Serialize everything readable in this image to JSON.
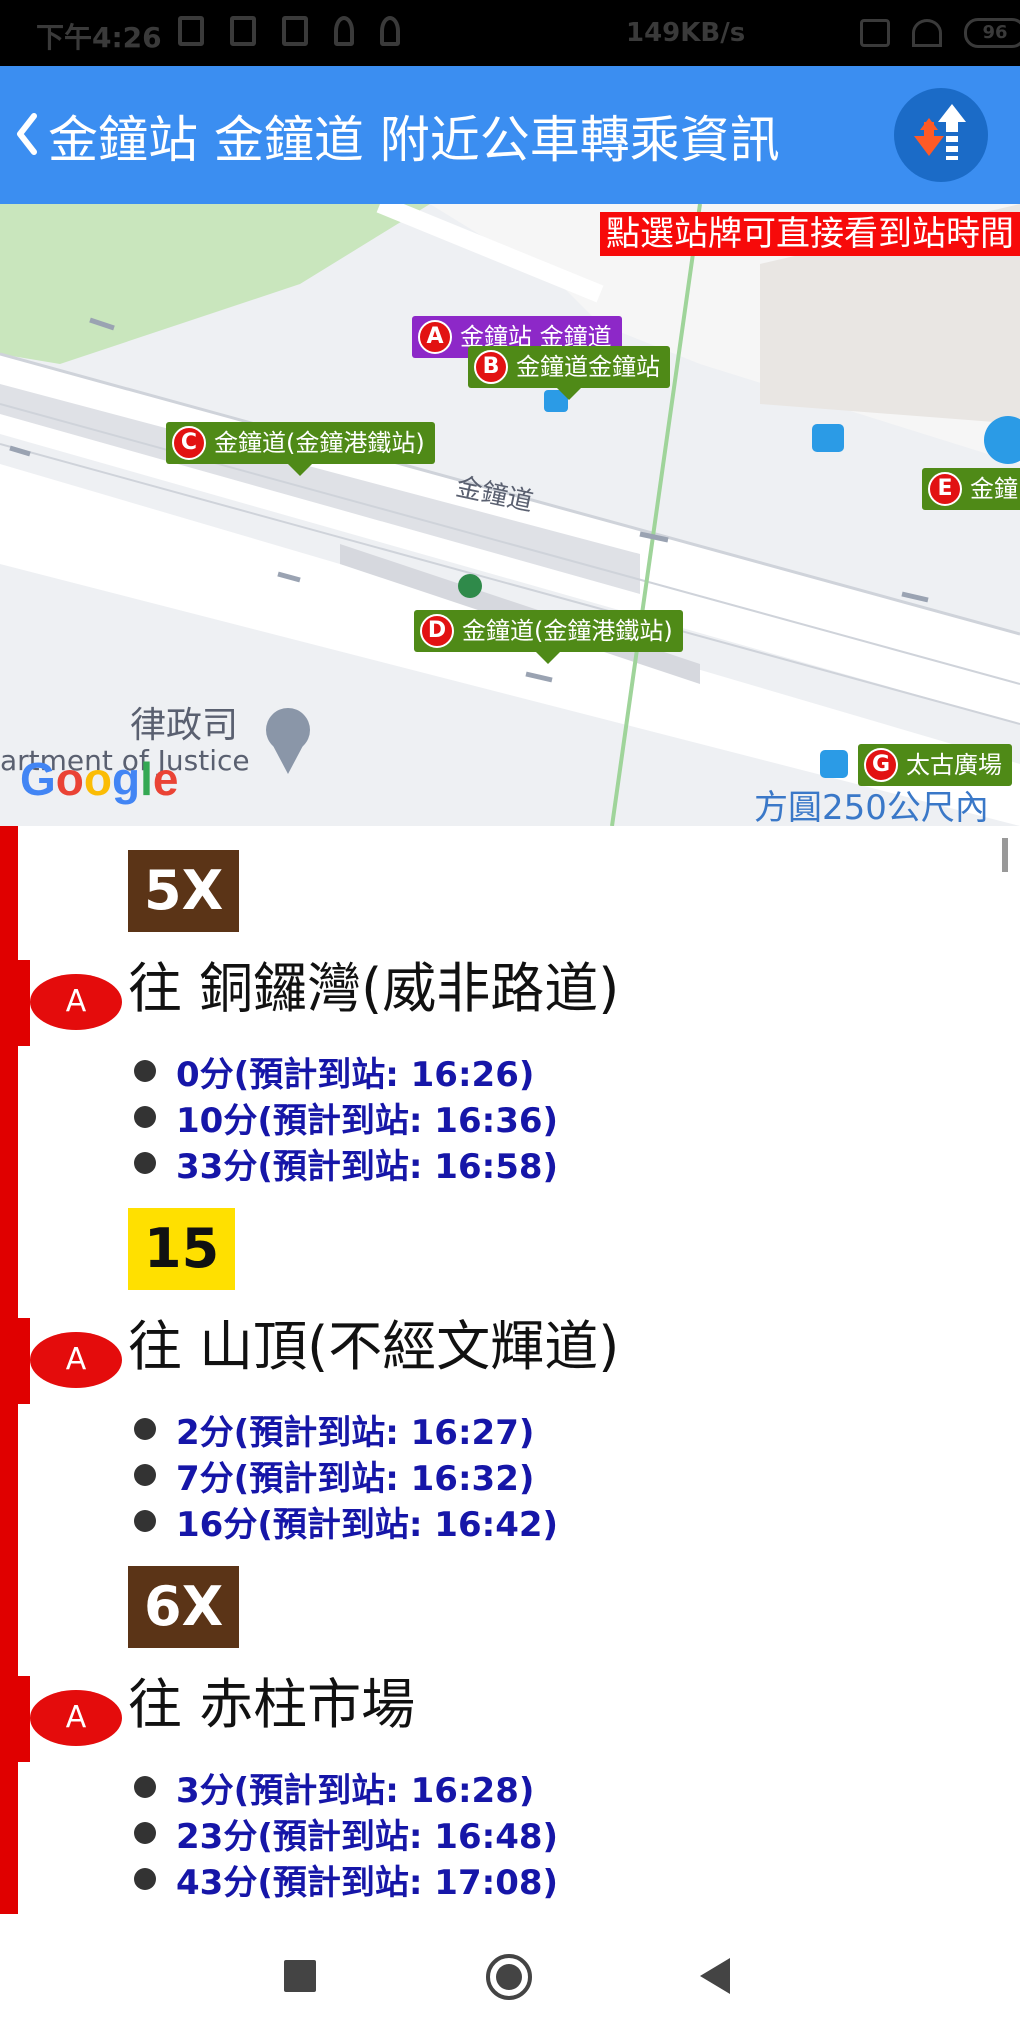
{
  "status_bar": {
    "time": "下午4:26",
    "net_speed": "149KB/s",
    "battery": "96"
  },
  "header": {
    "title": "金鐘站 金鐘道  附近公車轉乘資訊",
    "sort_icon": "sort-updown-icon",
    "color": "#3b8ef1"
  },
  "map": {
    "notice": "點選站牌可直接看到站時間",
    "markers": [
      {
        "letter": "A",
        "label": "金鐘站 金鐘道"
      },
      {
        "letter": "B",
        "label": "金鐘道金鐘站"
      },
      {
        "letter": "C",
        "label": "金鐘道(金鐘港鐵站)"
      },
      {
        "letter": "D",
        "label": "金鐘道(金鐘港鐵站)"
      },
      {
        "letter": "E",
        "label": "金鐘"
      },
      {
        "letter": "G",
        "label": "太古廣場"
      }
    ],
    "road_label": "金鐘道",
    "poi_label": "律政司",
    "poi_label_en": "artment of Justice",
    "logo": "Google",
    "radius_label": "方圓250公尺內"
  },
  "routes": [
    {
      "number": "5X",
      "badge_bg": "#5b3417",
      "badge_fg": "#ffffff",
      "stop": "A",
      "destination": "往 銅鑼灣(威非路道)",
      "etas": [
        "0分(預計到站: 16:26)",
        "10分(預計到站: 16:36)",
        "33分(預計到站: 16:58)"
      ]
    },
    {
      "number": "15",
      "badge_bg": "#ffe000",
      "badge_fg": "#111111",
      "stop": "A",
      "destination": "往 山頂(不經文輝道)",
      "etas": [
        "2分(預計到站: 16:27)",
        "7分(預計到站: 16:32)",
        "16分(預計到站: 16:42)"
      ]
    },
    {
      "number": "6X",
      "badge_bg": "#5b3417",
      "badge_fg": "#ffffff",
      "stop": "A",
      "destination": "往 赤柱市場",
      "etas": [
        "3分(預計到站: 16:28)",
        "23分(預計到站: 16:48)",
        "43分(預計到站: 17:08)"
      ]
    }
  ],
  "nav_bar": {
    "recent_icon": "square-icon",
    "home_icon": "circle-icon",
    "back_icon": "triangle-back-icon"
  }
}
